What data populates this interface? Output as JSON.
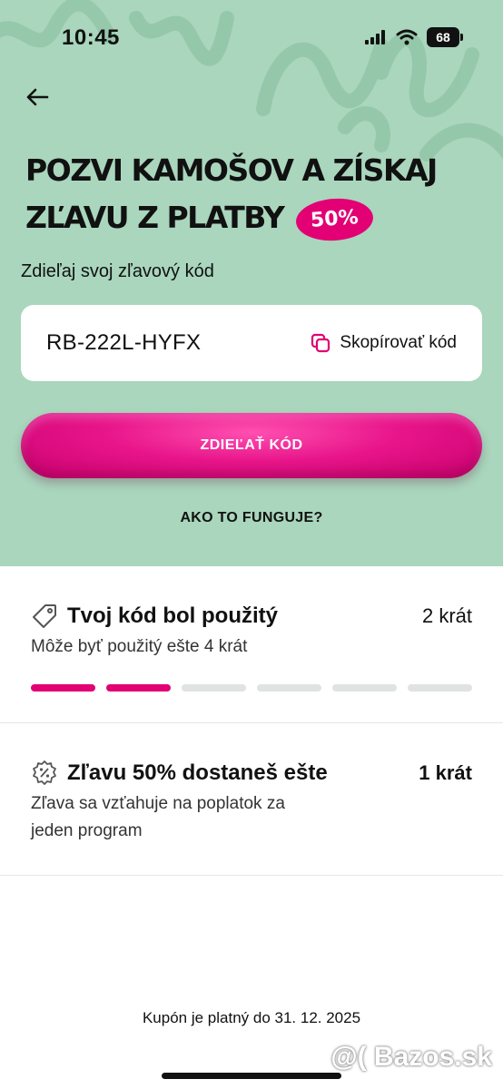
{
  "status_bar": {
    "time": "10:45",
    "battery": "68"
  },
  "header": {
    "title_line1": "POZVI KAMOŠOV A ZÍSKAJ",
    "title_line2": "ZĽAVU Z PLATBY",
    "badge": "50%"
  },
  "share": {
    "label": "Zdieľaj svoj zľavový kód",
    "code": "RB-222L-HYFX",
    "copy_label": "Skopírovať kód",
    "share_button": "ZDIEĽAŤ KÓD",
    "how_link": "AKO TO FUNGUJE?"
  },
  "usage": {
    "title": "Tvoj kód bol použitý",
    "count": "2 krát",
    "subtitle": "Môže byť použitý ešte 4 krát",
    "progress_used": 2,
    "progress_total": 6
  },
  "discount": {
    "title": "Zľavu 50% dostaneš ešte",
    "count": "1 krát",
    "subtitle": "Zľava sa vzťahuje na poplatok za jeden program"
  },
  "footer": {
    "valid_text": "Kupón je platný do 31. 12. 2025"
  },
  "watermark": "@( Bazos.sk",
  "colors": {
    "accent": "#e20074",
    "hero_bg": "#a9d6bd"
  }
}
